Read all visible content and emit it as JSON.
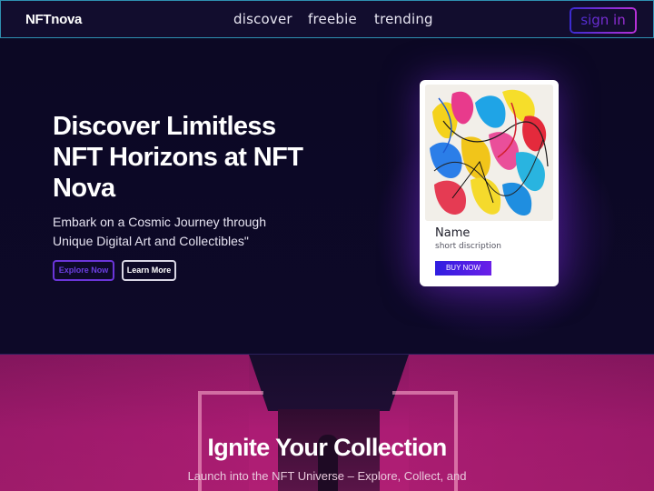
{
  "navbar": {
    "logo": "NFTnova",
    "links": [
      "discover",
      "freebie",
      "trending"
    ],
    "signin_label": "sign in",
    "border_color": "#2e8fb0"
  },
  "hero": {
    "title": "Discover Limitless NFT Horizons at NFT Nova",
    "subtitle": "Embark on a Cosmic Journey through Unique Digital Art and Collectibles\"",
    "explore_label": "Explore Now",
    "learn_label": "Learn More"
  },
  "card": {
    "image_icon": "abstract-art-image",
    "name": "Name",
    "description": "short discription",
    "buy_label": "BUY NOW",
    "buy_color": "#3a1fe4"
  },
  "section2": {
    "title": "Ignite Your Collection",
    "subtitle": "Launch into the NFT Universe – Explore, Collect, and",
    "accent": "#ac1c74"
  }
}
